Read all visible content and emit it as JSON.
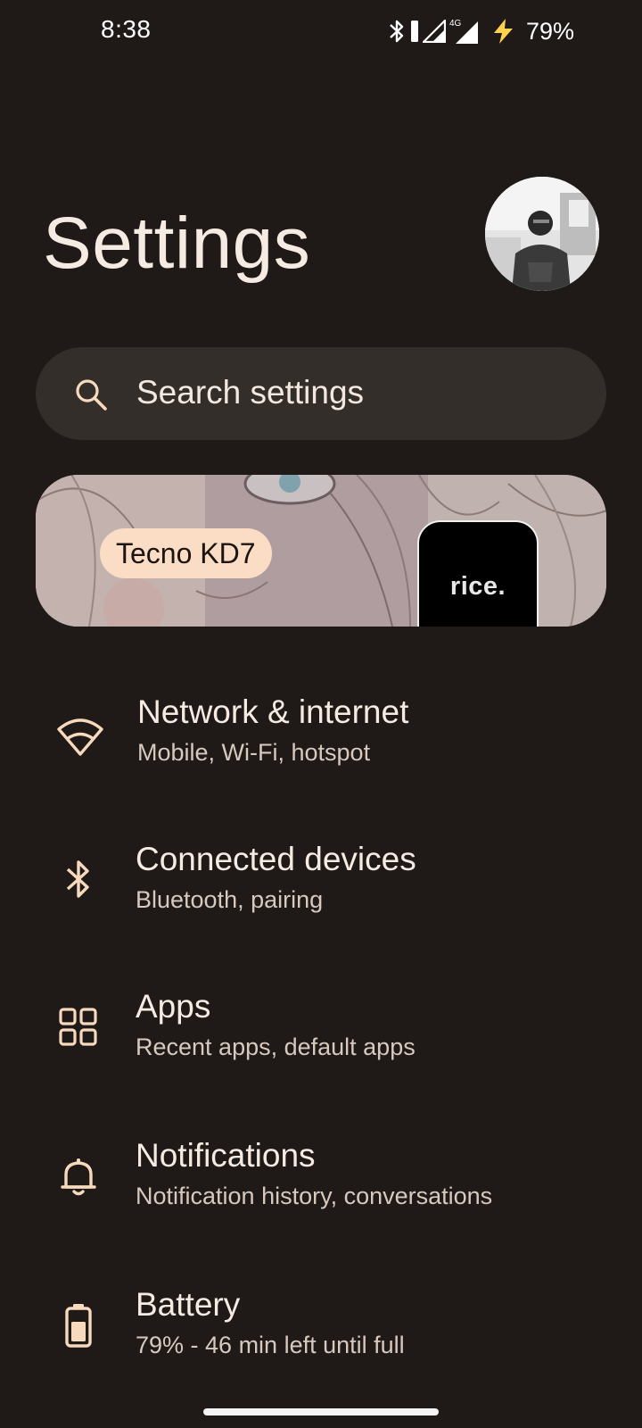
{
  "status_bar": {
    "time": "8:38",
    "network_type": "4G",
    "battery_percent": "79%",
    "icons": [
      "bluetooth-icon",
      "vibrate-icon",
      "signal-icon",
      "signal-4g-icon",
      "charging-icon"
    ]
  },
  "header": {
    "title": "Settings"
  },
  "search": {
    "placeholder": "Search settings"
  },
  "banner": {
    "device_name": "Tecno KD7",
    "phone_label": "rice."
  },
  "settings": [
    {
      "title": "Network & internet",
      "subtitle": "Mobile, Wi-Fi, hotspot",
      "icon": "wifi-icon"
    },
    {
      "title": "Connected devices",
      "subtitle": "Bluetooth, pairing",
      "icon": "bluetooth-icon"
    },
    {
      "title": "Apps",
      "subtitle": "Recent apps, default apps",
      "icon": "apps-grid-icon"
    },
    {
      "title": "Notifications",
      "subtitle": "Notification history, conversations",
      "icon": "bell-icon"
    },
    {
      "title": "Battery",
      "subtitle": "79% - 46 min left until full",
      "icon": "battery-icon"
    }
  ],
  "colors": {
    "background": "#1f1a17",
    "surface": "#342e2b",
    "accent": "#fbdcc4",
    "icon": "#f7d9bd"
  }
}
